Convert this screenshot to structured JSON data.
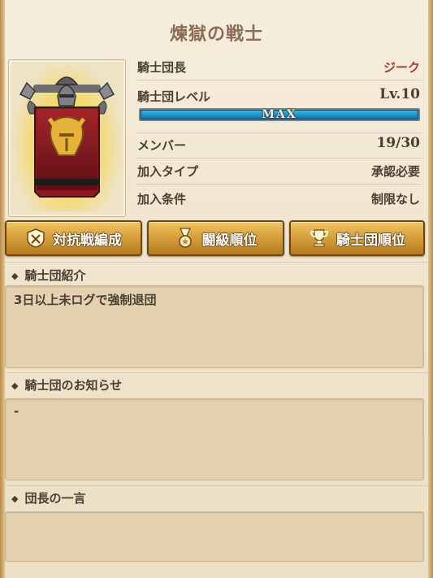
{
  "title": "煉獄の戦士",
  "info": {
    "leader_label": "騎士団長",
    "leader_value": "ジーク",
    "level_label": "騎士団レベル",
    "level_value": "Lv.10",
    "level_bar_text": "MAX",
    "level_progress": 1.0,
    "members_label": "メンバー",
    "members_value": "19/30",
    "join_type_label": "加入タイプ",
    "join_type_value": "承認必要",
    "join_cond_label": "加入条件",
    "join_cond_value": "制限なし"
  },
  "buttons": {
    "battle_formation": "対抗戦編成",
    "fight_rank": "闘級順位",
    "guild_rank": "騎士団順位"
  },
  "sections": {
    "intro_heading": "騎士団紹介",
    "intro_text": "3日以上未ログで強制退団",
    "notice_heading": "騎士団のお知らせ",
    "notice_text": "-",
    "leader_msg_heading": "団長の一言",
    "leader_msg_text": ""
  },
  "colors": {
    "accent_gold": "#d9a13d",
    "leader_name": "#9c3c2e",
    "level_bar": "#1e8fc3"
  }
}
